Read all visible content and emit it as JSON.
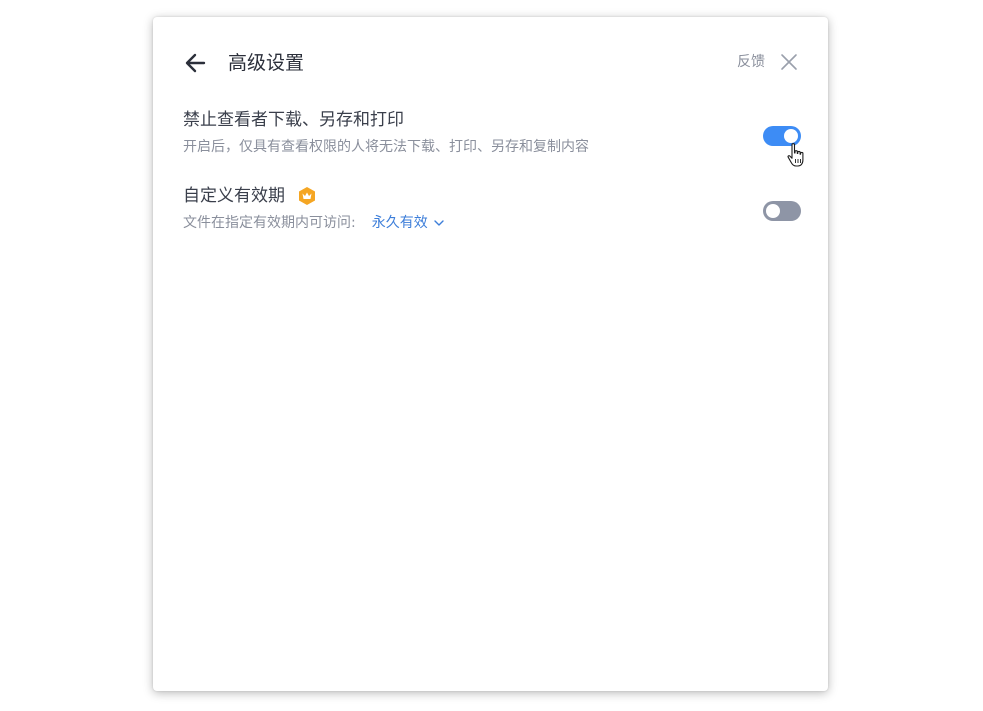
{
  "header": {
    "title": "高级设置",
    "feedback_label": "反馈"
  },
  "settings": [
    {
      "title": "禁止查看者下载、另存和打印",
      "description": "开启后，仅具有查看权限的人将无法下载、打印、另存和复制内容",
      "toggle_on": true
    },
    {
      "title": "自定义有效期",
      "description": "文件在指定有效期内可访问:",
      "select_value": "永久有效",
      "premium_badge": "crown-icon",
      "toggle_on": false
    }
  ],
  "colors": {
    "toggle_on": "#3d8cf5",
    "toggle_off": "#8e95a6",
    "link": "#3d7ed9",
    "premium": "#f5a623"
  }
}
